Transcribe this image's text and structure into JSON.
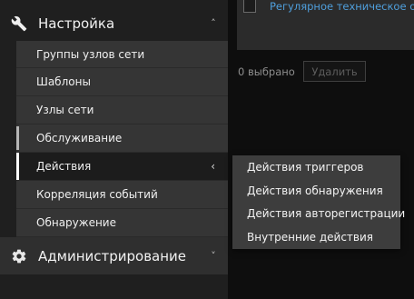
{
  "sidebar": {
    "config": {
      "label": "Настройка",
      "icon": "wrench-icon",
      "chevron": "˄",
      "items": [
        {
          "label": "Группы узлов сети"
        },
        {
          "label": "Шаблоны"
        },
        {
          "label": "Узлы сети"
        },
        {
          "label": "Обслуживание"
        },
        {
          "label": "Действия",
          "arrow": "‹"
        },
        {
          "label": "Корреляция событий"
        },
        {
          "label": "Обнаружение"
        }
      ]
    },
    "admin": {
      "label": "Администрирование",
      "icon": "gear-icon",
      "chevron": "˅"
    }
  },
  "main": {
    "table_row_link": "Регулярное техническое обс",
    "selected_count": "0 выбрано",
    "delete_label": "Удалить"
  },
  "flyout": {
    "items": [
      {
        "label": "Действия триггеров"
      },
      {
        "label": "Действия обнаружения"
      },
      {
        "label": "Действия авторегистрации"
      },
      {
        "label": "Внутренние действия"
      }
    ]
  },
  "colors": {
    "link": "#4f9fdc",
    "sidebar_bg": "#1f1f1f",
    "submenu_bg": "#353535",
    "flyout_bg": "#3d3d3d"
  }
}
